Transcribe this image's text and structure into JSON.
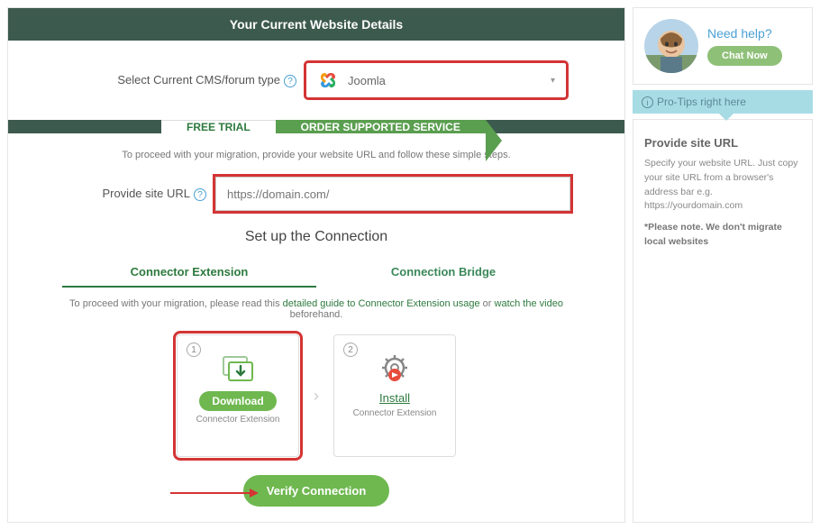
{
  "header": {
    "title": "Your Current Website Details"
  },
  "cms": {
    "label": "Select Current CMS/forum type",
    "value": "Joomla"
  },
  "tabs": {
    "free": "FREE TRIAL",
    "order": "ORDER SUPPORTED SERVICE"
  },
  "instruction1": "To proceed with your migration, provide your website URL and follow these simple steps.",
  "url": {
    "label": "Provide site URL",
    "placeholder": "https://domain.com/"
  },
  "setup": {
    "title": "Set up the Connection"
  },
  "subtabs": {
    "ext": "Connector Extension",
    "bridge": "Connection Bridge"
  },
  "instruction2": {
    "pre": "To proceed with your migration, please read this ",
    "link1": "detailed guide to Connector Extension usage",
    "mid": " or ",
    "link2": "watch the video",
    "post": " beforehand."
  },
  "cards": {
    "download": {
      "step": "1",
      "btn": "Download",
      "sub": "Connector Extension"
    },
    "install": {
      "step": "2",
      "link": "Install",
      "sub": "Connector Extension"
    }
  },
  "verify": {
    "label": "Verify Connection"
  },
  "help": {
    "title": "Need help?",
    "chat": "Chat Now"
  },
  "tips": {
    "header": "Pro-Tips right here",
    "title": "Provide site URL",
    "body": "Specify your website URL. Just copy your site URL from a browser's address bar e.g. https://yourdomain.com",
    "note": "*Please note. We don't migrate local websites"
  }
}
